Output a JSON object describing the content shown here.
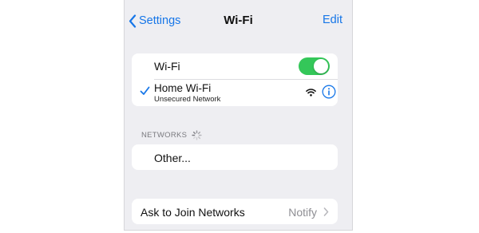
{
  "colors": {
    "accent": "#1676e8",
    "toggle_on": "#34c759",
    "background": "#eeeef2"
  },
  "navbar": {
    "back_label": "Settings",
    "back_icon": "chevron-left-icon",
    "title": "Wi-Fi",
    "edit_label": "Edit"
  },
  "wifi_toggle": {
    "label": "Wi-Fi",
    "state": "on"
  },
  "current_network": {
    "name": "Home Wi-Fi",
    "subtitle": "Unsecured Network",
    "connected": true,
    "icons": [
      "checkmark-icon",
      "wifi-signal-icon",
      "info-icon"
    ]
  },
  "networks_section": {
    "header": "NETWORKS",
    "loading": true,
    "items": [
      {
        "label": "Other..."
      }
    ]
  },
  "ask_to_join": {
    "label": "Ask to Join Networks",
    "value": "Notify"
  }
}
